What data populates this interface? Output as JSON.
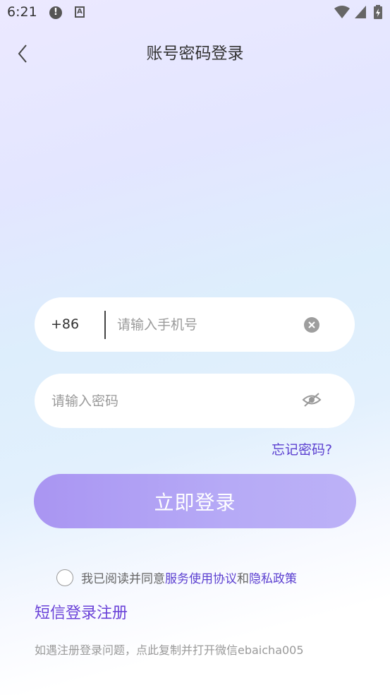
{
  "status_bar": {
    "time": "6:21",
    "icons": [
      "alert-icon",
      "a-icon",
      "wifi-icon",
      "signal-icon",
      "battery-icon"
    ],
    "alert_glyph": "!",
    "a_glyph": "A"
  },
  "header": {
    "title": "账号密码登录",
    "back_icon": "chevron-left-icon"
  },
  "form": {
    "country_code": "+86",
    "phone_placeholder": "请输入手机号",
    "password_placeholder": "请输入密码",
    "forgot_label": "忘记密码?",
    "login_label": "立即登录"
  },
  "agreement": {
    "prefix": "我已阅读并同意",
    "service_link": "服务使用协议",
    "and": "和",
    "privacy_link": "隐私政策",
    "checked": false
  },
  "sms_login_label": "短信登录注册",
  "help_text": "如遇注册登录问题，点此复制并打开微信ebaicha005",
  "colors": {
    "accent": "#5b3fd0",
    "button": "#b3a6f5"
  }
}
